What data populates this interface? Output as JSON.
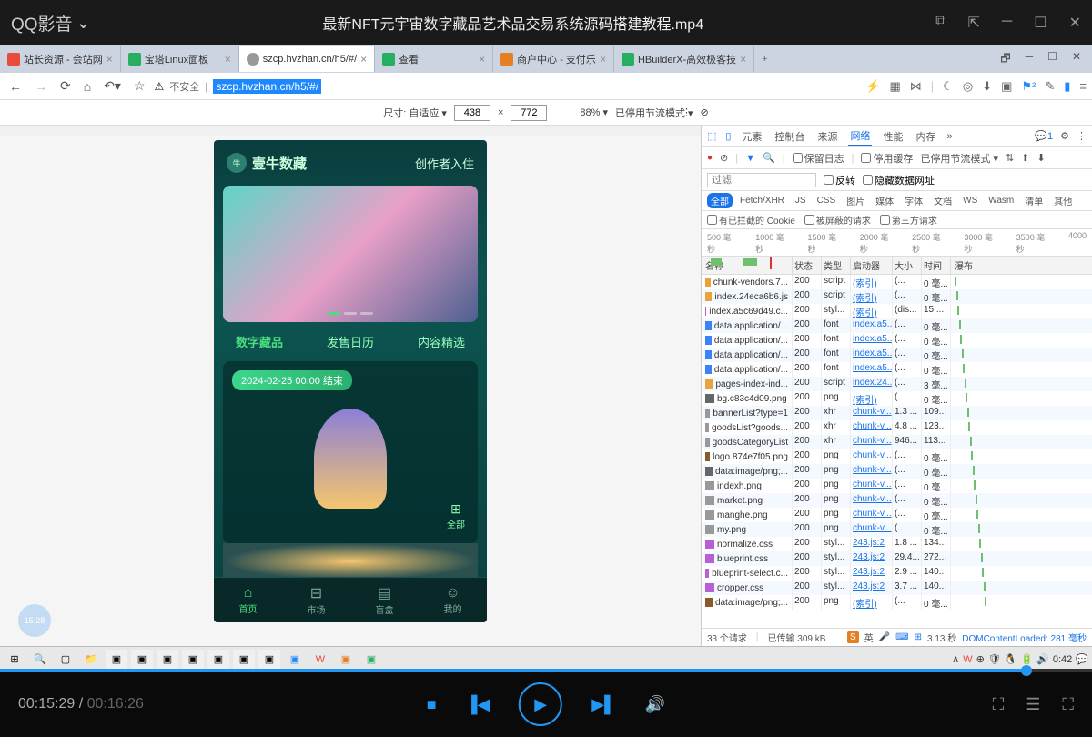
{
  "titlebar": {
    "app_name": "QQ影音",
    "file_name": "最新NFT元宇宙数字藏品艺术品交易系统源码搭建教程.mp4"
  },
  "tabs": [
    {
      "label": "站长资源 - 会站网",
      "color": "#e74c3c"
    },
    {
      "label": "宝塔Linux面板",
      "color": "#27ae60"
    },
    {
      "label": "szcp.hvzhan.cn/h5/#/",
      "color": "#999",
      "active": true
    },
    {
      "label": "查看",
      "color": "#27ae60"
    },
    {
      "label": "商户中心 - 支付乐",
      "color": "#e67e22"
    },
    {
      "label": "HBuilderX-高效极客技",
      "color": "#27ae60"
    }
  ],
  "addr": {
    "insecure_label": "不安全",
    "url": "szcp.hvzhan.cn/h5/#/"
  },
  "dim": {
    "size_label": "尺寸: 自适应 ▾",
    "width": "438",
    "height": "772",
    "zoom": "88% ▾",
    "throttle": "已停用节流模式 ▾"
  },
  "phone": {
    "brand": "壹牛数藏",
    "action": "创作者入住",
    "tabs": [
      "数字藏品",
      "发售日历",
      "内容精选"
    ],
    "badge": "2024-02-25 00:00 结束",
    "grid_label": "全部",
    "nav": [
      {
        "label": "首页",
        "icon": "⌂"
      },
      {
        "label": "市场",
        "icon": "⊟"
      },
      {
        "label": "盲盒",
        "icon": "▤"
      },
      {
        "label": "我的",
        "icon": "☺"
      }
    ]
  },
  "devtools": {
    "tabs": [
      "元素",
      "控制台",
      "来源",
      "网络",
      "性能",
      "内存"
    ],
    "active_tab": "网络",
    "msg_count": "1",
    "preserve_log": "保留日志",
    "disable_cache": "停用缓存",
    "throttle_devtools": "已停用节流模式 ▾",
    "filter_placeholder": "过滤",
    "invert": "反转",
    "hide_data": "隐藏数据网址",
    "types": [
      "全部",
      "Fetch/XHR",
      "JS",
      "CSS",
      "图片",
      "媒体",
      "字体",
      "文档",
      "WS",
      "Wasm",
      "清单",
      "其他"
    ],
    "cookie_blocked": "有已拦截的 Cookie",
    "blocked_req": "被屏蔽的请求",
    "third_party": "第三方请求",
    "timeline": [
      "500 毫秒",
      "1000 毫秒",
      "1500 毫秒",
      "2000 毫秒",
      "2500 毫秒",
      "3000 毫秒",
      "3500 毫秒",
      "4000"
    ],
    "headers": {
      "name": "名称",
      "status": "状态",
      "type": "类型",
      "initiator": "启动器",
      "size": "大小",
      "time": "时间",
      "waterfall": "瀑布"
    },
    "rows": [
      {
        "name": "chunk-vendors.7...",
        "status": "200",
        "type": "script",
        "init": "(索引)",
        "size": "(...",
        "time": "0 毫...",
        "ico": "#e8a33c"
      },
      {
        "name": "index.24eca6b6.js",
        "status": "200",
        "type": "script",
        "init": "(索引)",
        "size": "(...",
        "time": "0 毫...",
        "ico": "#e8a33c"
      },
      {
        "name": "index.a5c69d49.c...",
        "status": "200",
        "type": "styl...",
        "init": "(索引)",
        "size": "(dis...",
        "time": "15 ...",
        "ico": "#b95fd6"
      },
      {
        "name": "data:application/...",
        "status": "200",
        "type": "font",
        "init": "index.a5...",
        "size": "(...",
        "time": "0 毫...",
        "ico": "#3b82f6"
      },
      {
        "name": "data:application/...",
        "status": "200",
        "type": "font",
        "init": "index.a5...",
        "size": "(...",
        "time": "0 毫...",
        "ico": "#3b82f6"
      },
      {
        "name": "data:application/...",
        "status": "200",
        "type": "font",
        "init": "index.a5...",
        "size": "(...",
        "time": "0 毫...",
        "ico": "#3b82f6"
      },
      {
        "name": "data:application/...",
        "status": "200",
        "type": "font",
        "init": "index.a5...",
        "size": "(...",
        "time": "0 毫...",
        "ico": "#3b82f6"
      },
      {
        "name": "pages-index-ind...",
        "status": "200",
        "type": "script",
        "init": "index.24...",
        "size": "(...",
        "time": "3 毫...",
        "ico": "#e8a33c"
      },
      {
        "name": "bg.c83c4d09.png",
        "status": "200",
        "type": "png",
        "init": "(索引)",
        "size": "(...",
        "time": "0 毫...",
        "ico": "#666"
      },
      {
        "name": "bannerList?type=1",
        "status": "200",
        "type": "xhr",
        "init": "chunk-v...",
        "size": "1.3 ...",
        "time": "109...",
        "ico": "#999"
      },
      {
        "name": "goodsList?goods...",
        "status": "200",
        "type": "xhr",
        "init": "chunk-v...",
        "size": "4.8 ...",
        "time": "123...",
        "ico": "#999"
      },
      {
        "name": "goodsCategoryList",
        "status": "200",
        "type": "xhr",
        "init": "chunk-v...",
        "size": "946...",
        "time": "113...",
        "ico": "#999"
      },
      {
        "name": "logo.874e7f05.png",
        "status": "200",
        "type": "png",
        "init": "chunk-v...",
        "size": "(...",
        "time": "0 毫...",
        "ico": "#8b5a2b"
      },
      {
        "name": "data:image/png;...",
        "status": "200",
        "type": "png",
        "init": "chunk-v...",
        "size": "(...",
        "time": "0 毫...",
        "ico": "#666"
      },
      {
        "name": "indexh.png",
        "status": "200",
        "type": "png",
        "init": "chunk-v...",
        "size": "(...",
        "time": "0 毫...",
        "ico": "#999"
      },
      {
        "name": "market.png",
        "status": "200",
        "type": "png",
        "init": "chunk-v...",
        "size": "(...",
        "time": "0 毫...",
        "ico": "#999"
      },
      {
        "name": "manghe.png",
        "status": "200",
        "type": "png",
        "init": "chunk-v...",
        "size": "(...",
        "time": "0 毫...",
        "ico": "#999"
      },
      {
        "name": "my.png",
        "status": "200",
        "type": "png",
        "init": "chunk-v...",
        "size": "(...",
        "time": "0 毫...",
        "ico": "#999"
      },
      {
        "name": "normalize.css",
        "status": "200",
        "type": "styl...",
        "init": "243.js:2",
        "size": "1.8 ...",
        "time": "134...",
        "ico": "#b95fd6"
      },
      {
        "name": "blueprint.css",
        "status": "200",
        "type": "styl...",
        "init": "243.js:2",
        "size": "29.4...",
        "time": "272...",
        "ico": "#b95fd6"
      },
      {
        "name": "blueprint-select.c...",
        "status": "200",
        "type": "styl...",
        "init": "243.js:2",
        "size": "2.9 ...",
        "time": "140...",
        "ico": "#b95fd6"
      },
      {
        "name": "cropper.css",
        "status": "200",
        "type": "styl...",
        "init": "243.js:2",
        "size": "3.7 ...",
        "time": "140...",
        "ico": "#b95fd6"
      },
      {
        "name": "data:image/png;...",
        "status": "200",
        "type": "png",
        "init": "(索引)",
        "size": "(...",
        "time": "0 毫...",
        "ico": "#8b5a2b"
      }
    ],
    "status_bar": {
      "requests": "33 个请求",
      "transferred": "已传输 309 kB",
      "ime": "英",
      "time": "3.13 秒",
      "dom_loaded_label": "DOMContentLoaded:",
      "dom_loaded_val": "281 毫秒"
    }
  },
  "os_time": "0:42",
  "player": {
    "current": "00:15:29",
    "total": "00:16:26"
  },
  "badge_time": "15:28"
}
